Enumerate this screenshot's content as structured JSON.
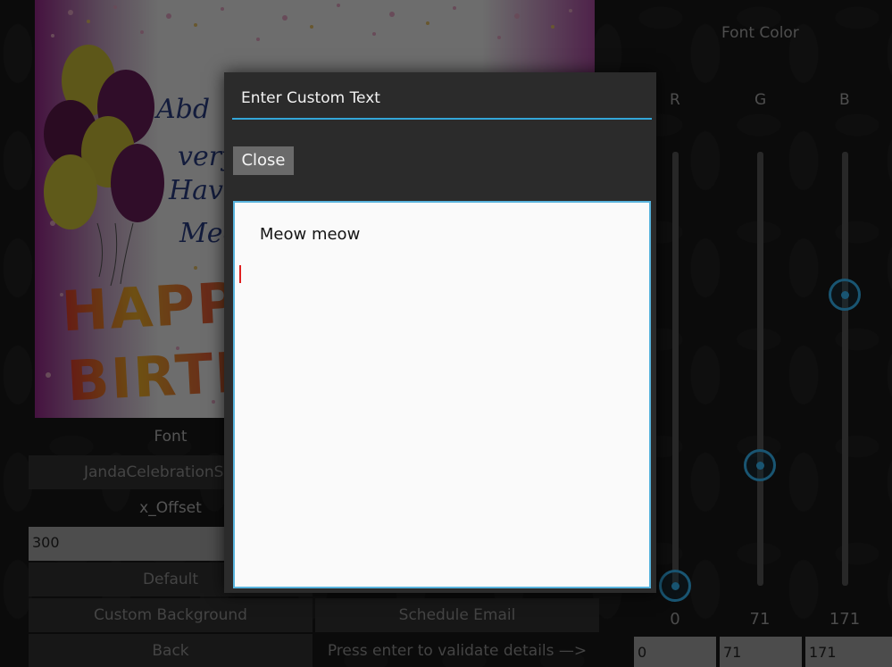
{
  "left_panel": {
    "font_label": "Font",
    "font_value": "JandaCelebrationS",
    "x_offset_label": "x_Offset",
    "x_offset_value": "300",
    "default_button": "Default",
    "custom_background_button": "Custom Background",
    "schedule_email_button": "Schedule Email",
    "back_button": "Back",
    "validate_hint": "Press enter to validate details —>"
  },
  "card": {
    "line1": "Abd",
    "line2": "very",
    "line3": "Hav",
    "line4": "Mec",
    "happy": "HAPPY",
    "birthday": "BIRTHI"
  },
  "font_color": {
    "title": "Font Color",
    "channels": [
      {
        "label": "R",
        "value": "0",
        "level": 0
      },
      {
        "label": "G",
        "value": "71",
        "level": 71
      },
      {
        "label": "B",
        "value": "171",
        "level": 171
      }
    ],
    "max": 255,
    "accent": "#2f9ccf"
  },
  "modal": {
    "title": "Enter Custom Text",
    "close_button": "Close",
    "text_value": "Meow meow"
  }
}
